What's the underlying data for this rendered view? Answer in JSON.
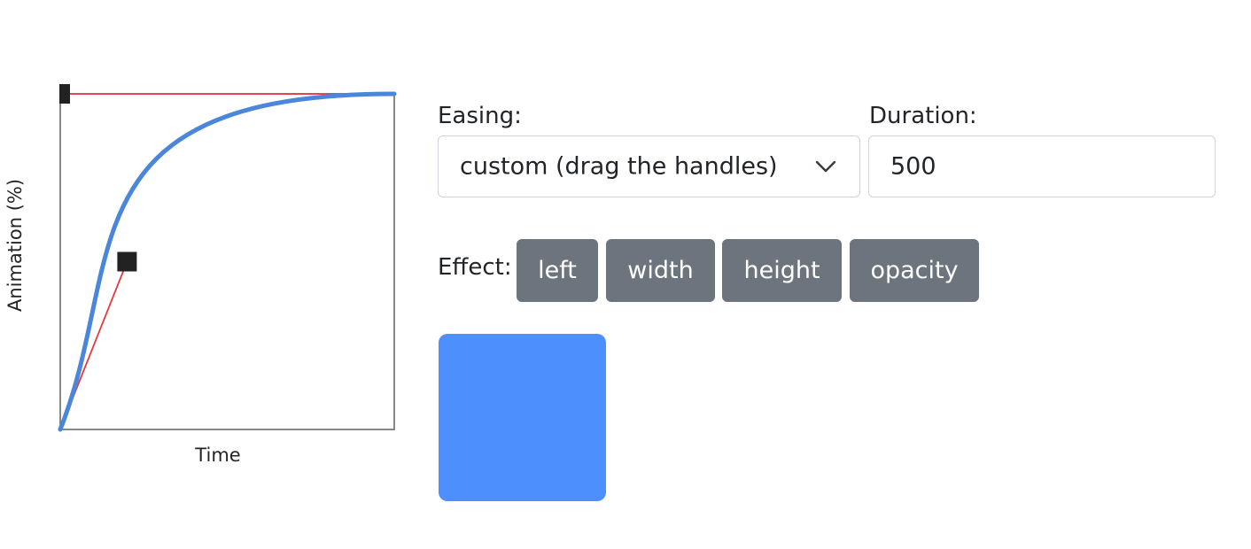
{
  "editor": {
    "y_axis_label": "Animation (%)",
    "x_axis_label": "Time",
    "curve_color": "#4a86d9",
    "handle_line_color": "#e8383d",
    "handle_color": "#222222",
    "control_points": {
      "p1": [
        0.2,
        0.5
      ],
      "p2": [
        0.0,
        1.0
      ]
    }
  },
  "controls": {
    "easing_label": "Easing:",
    "easing_value": "custom (drag the handles)",
    "duration_label": "Duration:",
    "duration_value": "500",
    "effect_label": "Effect:",
    "effects": [
      "left",
      "width",
      "height",
      "opacity"
    ],
    "button_color": "#6c757d"
  },
  "preview": {
    "box_color": "#4d8ffd"
  }
}
